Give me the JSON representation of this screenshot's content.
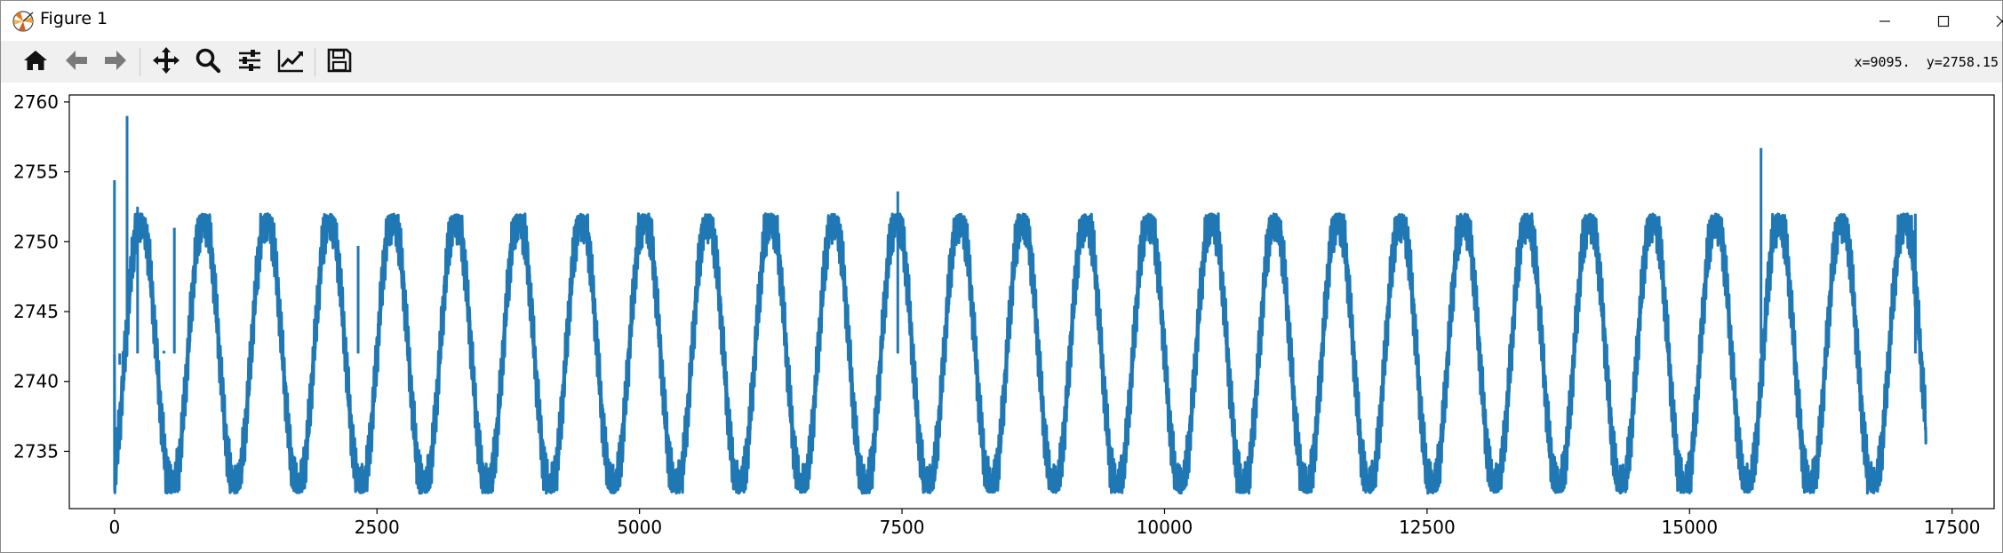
{
  "window": {
    "title": "Figure 1",
    "minimize_icon": "minimize-icon",
    "maximize_icon": "maximize-icon",
    "close_icon": "close-icon"
  },
  "toolbar": {
    "buttons": [
      {
        "name": "home-button",
        "icon": "home-icon"
      },
      {
        "name": "back-button",
        "icon": "arrow-left-icon"
      },
      {
        "name": "forward-button",
        "icon": "arrow-right-icon"
      },
      {
        "name": "pan-button",
        "icon": "move-icon"
      },
      {
        "name": "zoom-button",
        "icon": "magnifier-icon"
      },
      {
        "name": "subplots-button",
        "icon": "sliders-icon"
      },
      {
        "name": "edit-axis-button",
        "icon": "line-chart-icon"
      },
      {
        "name": "save-button",
        "icon": "floppy-disk-icon"
      }
    ],
    "coordinates": "x=9095.  y=2758.15"
  },
  "chart_data": {
    "type": "line",
    "title": "",
    "xlabel": "",
    "ylabel": "",
    "xlim": [
      -430,
      17900
    ],
    "ylim": [
      2730.9,
      2760.5
    ],
    "xticks": [
      0,
      2500,
      5000,
      7500,
      10000,
      12500,
      15000,
      17500
    ],
    "yticks": [
      2735,
      2740,
      2745,
      2750,
      2755,
      2760
    ],
    "xtick_labels": [
      "0",
      "2500",
      "5000",
      "7500",
      "10000",
      "12500",
      "15000",
      "17500"
    ],
    "ytick_labels": [
      "2735",
      "2740",
      "2745",
      "2750",
      "2755",
      "2760"
    ],
    "grid": false,
    "color": "#1f77b4",
    "series": [
      {
        "period": 600,
        "center": 2742,
        "amplitude": 10,
        "x_start": 0,
        "x_end": 17250,
        "min": 2732,
        "max": 2752,
        "start_value": 2742,
        "spikes": [
          {
            "x": 0,
            "y": 2754.4
          },
          {
            "x": 50,
            "y": 2741.2
          },
          {
            "x": 120,
            "y": 2759
          },
          {
            "x": 220,
            "y": 2752.5
          },
          {
            "x": 470,
            "y": 2742.2
          },
          {
            "x": 570,
            "y": 2751
          },
          {
            "x": 2320,
            "y": 2749.7
          },
          {
            "x": 7460,
            "y": 2753.6
          },
          {
            "x": 15680,
            "y": 2756.7
          },
          {
            "x": 17150,
            "y": 2752
          }
        ],
        "end_value": 2736
      }
    ]
  }
}
